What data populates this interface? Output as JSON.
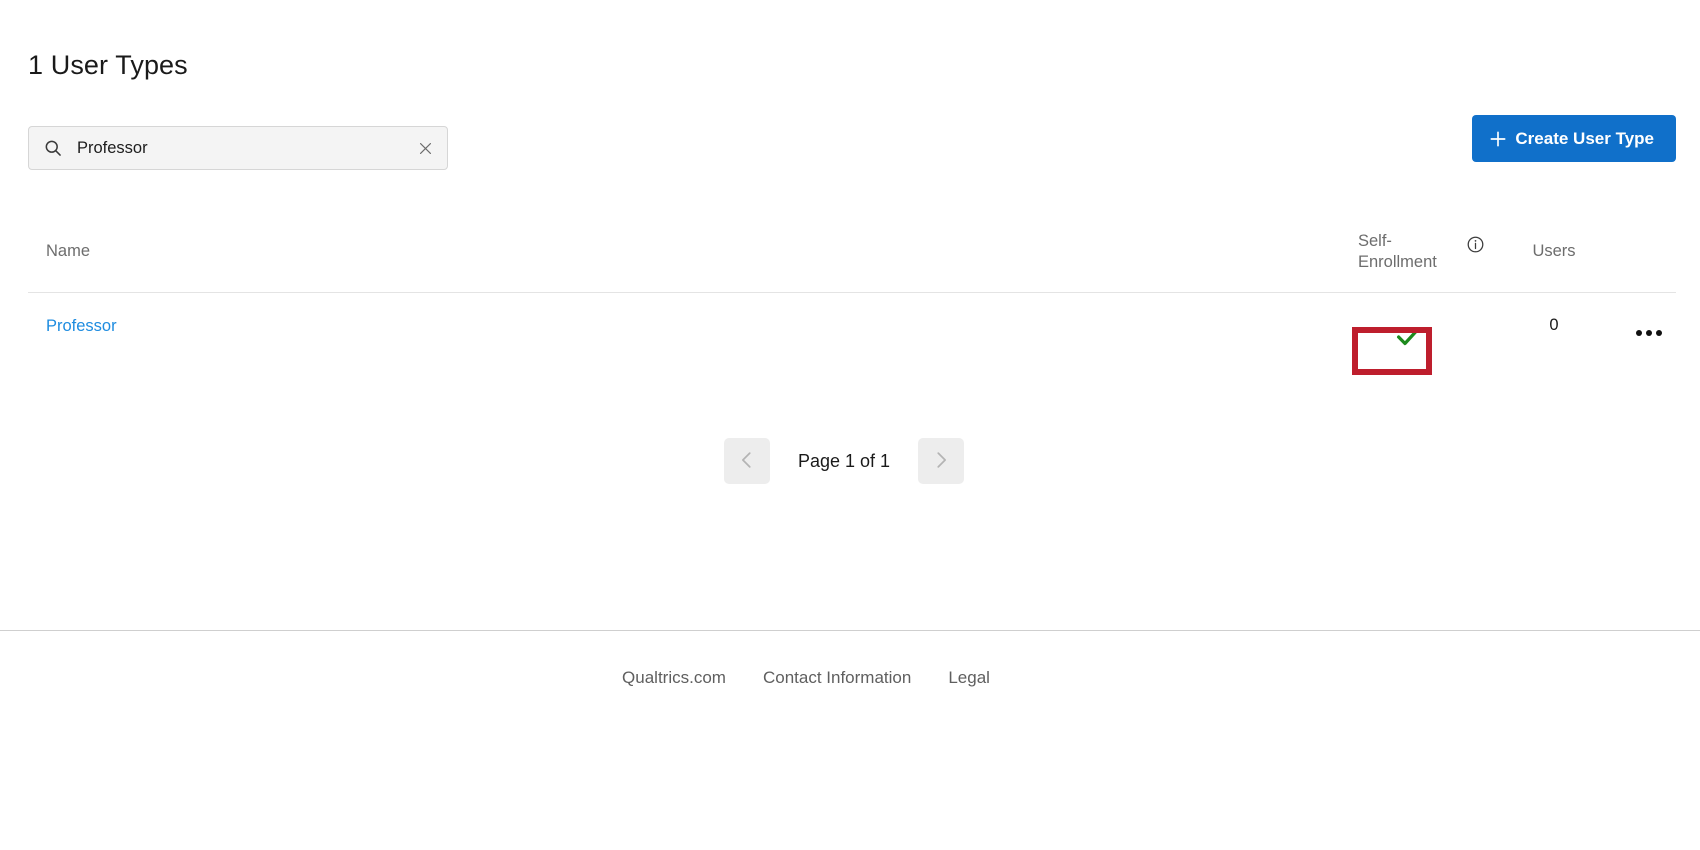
{
  "header": {
    "title": "1 User Types"
  },
  "search": {
    "value": "Professor",
    "placeholder": "Search",
    "icon": "search-icon",
    "clear_icon": "close-icon"
  },
  "toolbar": {
    "create_label": "Create User Type",
    "create_icon": "plus-icon",
    "accent_color": "#1070ca"
  },
  "table": {
    "columns": {
      "name": "Name",
      "self_enrollment": "Self-Enrollment",
      "self_enrollment_info_icon": "info-icon",
      "users": "Users"
    },
    "rows": [
      {
        "name": "Professor",
        "self_enrollment": true,
        "self_enrollment_icon": "check-icon",
        "users": "0",
        "menu_icon": "ellipsis-icon"
      }
    ]
  },
  "annotation": {
    "target": "self-enrollment-cell",
    "color": "#be1e2d"
  },
  "pagination": {
    "prev_icon": "chevron-left-icon",
    "next_icon": "chevron-right-icon",
    "label": "Page 1 of 1",
    "prev_enabled": false,
    "next_enabled": false
  },
  "footer": {
    "links": [
      {
        "label": "Qualtrics.com"
      },
      {
        "label": "Contact Information"
      },
      {
        "label": "Legal"
      }
    ]
  },
  "colors": {
    "link": "#1e8ce0",
    "check_green": "#1d8a1d",
    "annotation_red": "#be1e2d",
    "button_blue": "#1070ca"
  }
}
